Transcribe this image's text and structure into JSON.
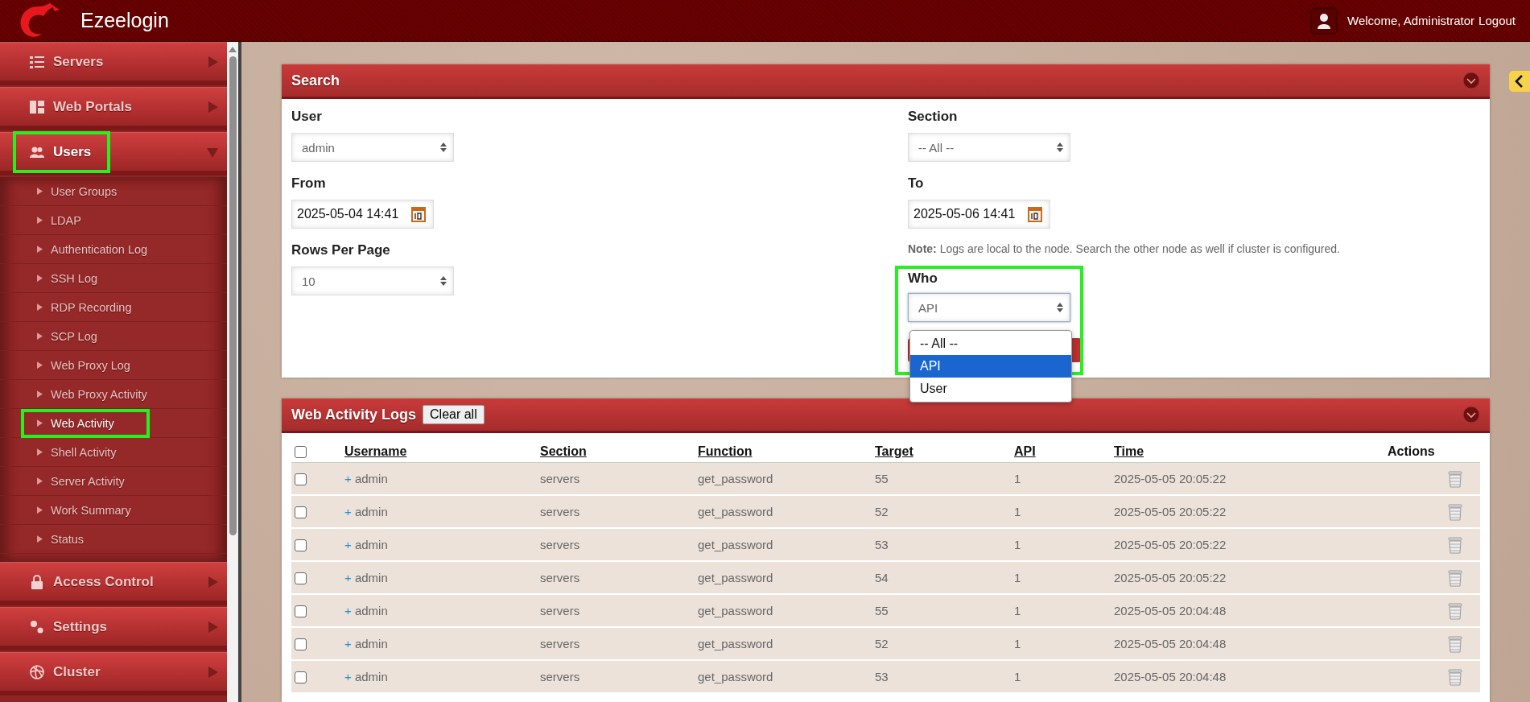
{
  "header": {
    "logo": "Ezeelogin",
    "welcome": "Welcome, Administrator",
    "logout": "Logout"
  },
  "sidebar": {
    "items": [
      {
        "label": "Servers",
        "expanded": false,
        "highlighted": false
      },
      {
        "label": "Web Portals",
        "expanded": false,
        "highlighted": false
      },
      {
        "label": "Users",
        "expanded": true,
        "highlighted": true,
        "children": [
          {
            "label": "User Groups",
            "selected": false,
            "highlighted": false
          },
          {
            "label": "LDAP",
            "selected": false,
            "highlighted": false
          },
          {
            "label": "Authentication Log",
            "selected": false,
            "highlighted": false
          },
          {
            "label": "SSH Log",
            "selected": false,
            "highlighted": false
          },
          {
            "label": "RDP Recording",
            "selected": false,
            "highlighted": false
          },
          {
            "label": "SCP Log",
            "selected": false,
            "highlighted": false
          },
          {
            "label": "Web Proxy Log",
            "selected": false,
            "highlighted": false
          },
          {
            "label": "Web Proxy Activity",
            "selected": false,
            "highlighted": false
          },
          {
            "label": "Web Activity",
            "selected": true,
            "highlighted": true
          },
          {
            "label": "Shell Activity",
            "selected": false,
            "highlighted": false
          },
          {
            "label": "Server Activity",
            "selected": false,
            "highlighted": false
          },
          {
            "label": "Work Summary",
            "selected": false,
            "highlighted": false
          },
          {
            "label": "Status",
            "selected": false,
            "highlighted": false
          }
        ]
      },
      {
        "label": "Access Control",
        "expanded": false,
        "highlighted": false
      },
      {
        "label": "Settings",
        "expanded": false,
        "highlighted": false
      },
      {
        "label": "Cluster",
        "expanded": false,
        "highlighted": false
      }
    ]
  },
  "search": {
    "title": "Search",
    "left": [
      {
        "kind": "select",
        "label": "User",
        "value": "admin"
      },
      {
        "kind": "date",
        "label": "From",
        "value": "2025-05-04 14:41"
      },
      {
        "kind": "select",
        "label": "Rows Per Page",
        "value": "10"
      }
    ],
    "right": [
      {
        "kind": "select",
        "label": "Section",
        "value": "-- All --"
      },
      {
        "kind": "date",
        "label": "To",
        "value": "2025-05-06 14:41"
      },
      {
        "kind": "note",
        "text": "**Note:** Logs are local to the node. Search the other node as well if cluster is configured."
      }
    ],
    "who": {
      "label": "Who",
      "value": "API",
      "highlighted": true,
      "open": true,
      "options": [
        {
          "label": "-- All --",
          "selected": false
        },
        {
          "label": "API",
          "selected": true
        },
        {
          "label": "User",
          "selected": false
        }
      ]
    }
  },
  "logs": {
    "title": "Web Activity Logs",
    "clear_button": "Clear all",
    "header_checked": false,
    "columns": [
      {
        "label": "Username",
        "sortable": true
      },
      {
        "label": "Section",
        "sortable": true
      },
      {
        "label": "Function",
        "sortable": true
      },
      {
        "label": "Target",
        "sortable": true
      },
      {
        "label": "API",
        "sortable": true
      },
      {
        "label": "Time",
        "sortable": true
      },
      {
        "label": "Actions",
        "sortable": false
      }
    ],
    "rows": [
      {
        "checked": false,
        "toggle": "+",
        "username": "admin",
        "section": "servers",
        "function": "get_password",
        "target": "55",
        "api": "1",
        "time": "2025-05-05 20:05:22"
      },
      {
        "checked": false,
        "toggle": "+",
        "username": "admin",
        "section": "servers",
        "function": "get_password",
        "target": "52",
        "api": "1",
        "time": "2025-05-05 20:05:22"
      },
      {
        "checked": false,
        "toggle": "+",
        "username": "admin",
        "section": "servers",
        "function": "get_password",
        "target": "53",
        "api": "1",
        "time": "2025-05-05 20:05:22"
      },
      {
        "checked": false,
        "toggle": "+",
        "username": "admin",
        "section": "servers",
        "function": "get_password",
        "target": "54",
        "api": "1",
        "time": "2025-05-05 20:05:22"
      },
      {
        "checked": false,
        "toggle": "+",
        "username": "admin",
        "section": "servers",
        "function": "get_password",
        "target": "55",
        "api": "1",
        "time": "2025-05-05 20:04:48"
      },
      {
        "checked": false,
        "toggle": "+",
        "username": "admin",
        "section": "servers",
        "function": "get_password",
        "target": "52",
        "api": "1",
        "time": "2025-05-05 20:04:48"
      },
      {
        "checked": false,
        "toggle": "+",
        "username": "admin",
        "section": "servers",
        "function": "get_password",
        "target": "53",
        "api": "1",
        "time": "2025-05-05 20:04:48"
      }
    ]
  }
}
